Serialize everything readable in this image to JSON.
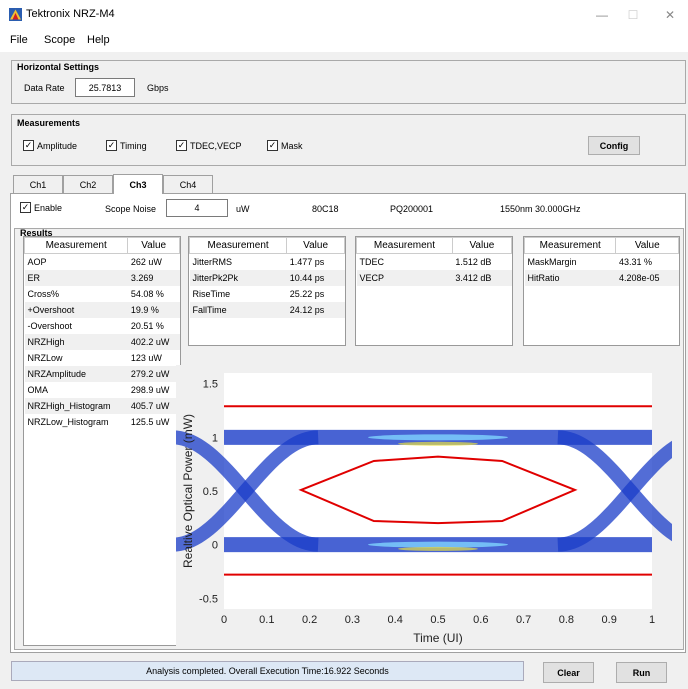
{
  "window": {
    "title": "Tektronix NRZ-M4",
    "minimize": "—",
    "maximize": "☐",
    "close": "✕"
  },
  "menu": {
    "file": "File",
    "scope": "Scope",
    "help": "Help"
  },
  "horizontal": {
    "title": "Horizontal Settings",
    "data_rate_label": "Data Rate",
    "data_rate_value": "25.7813",
    "unit": "Gbps"
  },
  "measurements": {
    "title": "Measurements",
    "amplitude": "Amplitude",
    "timing": "Timing",
    "tdec": "TDEC,VECP",
    "mask": "Mask",
    "config": "Config"
  },
  "tabs": [
    "Ch1",
    "Ch2",
    "Ch3",
    "Ch4"
  ],
  "channel": {
    "enable": "Enable",
    "scope_noise_label": "Scope Noise",
    "scope_noise_value": "4",
    "unit": "uW",
    "module": "80C18",
    "serial": "PQ200001",
    "config": "1550nm 30.000GHz"
  },
  "results": {
    "title": "Results",
    "header_measurement": "Measurement",
    "header_value": "Value",
    "amplitude": [
      [
        "AOP",
        "262  uW"
      ],
      [
        "ER",
        "3.269"
      ],
      [
        "Cross%",
        "54.08  %"
      ],
      [
        "+Overshoot",
        "19.9  %"
      ],
      [
        "-Overshoot",
        "20.51  %"
      ],
      [
        "NRZHigh",
        "402.2  uW"
      ],
      [
        "NRZLow",
        "123  uW"
      ],
      [
        "NRZAmplitude",
        "279.2  uW"
      ],
      [
        "OMA",
        "298.9  uW"
      ],
      [
        "NRZHigh_Histogram",
        "405.7  uW"
      ],
      [
        "NRZLow_Histogram",
        "125.5  uW"
      ]
    ],
    "timing": [
      [
        "JitterRMS",
        "1.477  ps"
      ],
      [
        "JitterPk2Pk",
        "10.44  ps"
      ],
      [
        "RiseTime",
        "25.22  ps"
      ],
      [
        "FallTime",
        "24.12  ps"
      ]
    ],
    "tdec": [
      [
        "TDEC",
        "1.512  dB"
      ],
      [
        "VECP",
        "3.412  dB"
      ]
    ],
    "mask": [
      [
        "MaskMargin",
        "43.31  %"
      ],
      [
        "HitRatio",
        "4.208e-05"
      ]
    ]
  },
  "chart_data": {
    "type": "scatter",
    "title": "",
    "xlabel": "Time (UI)",
    "ylabel": "Realtive Optical Power (mW)",
    "xlim": [
      0,
      1
    ],
    "ylim": [
      -0.6,
      1.6
    ],
    "xticks": [
      "0",
      "0.1",
      "0.2",
      "0.3",
      "0.4",
      "0.5",
      "0.6",
      "0.7",
      "0.8",
      "0.9",
      "1"
    ],
    "yticks": [
      "1.5",
      "1",
      "0.5",
      "0",
      "-0.5"
    ],
    "mask_color": "#e00000",
    "eye_color": "#1a3cc8",
    "mask_upper_line": 1.29,
    "mask_lower_line": -0.28,
    "mask_polygon": [
      [
        0.18,
        0.51
      ],
      [
        0.35,
        0.78
      ],
      [
        0.5,
        0.82
      ],
      [
        0.65,
        0.78
      ],
      [
        0.82,
        0.51
      ],
      [
        0.65,
        0.22
      ],
      [
        0.5,
        0.2
      ],
      [
        0.35,
        0.22
      ]
    ]
  },
  "status": {
    "message": "Analysis completed. Overall Execution Time:16.922 Seconds",
    "clear": "Clear",
    "run": "Run"
  }
}
